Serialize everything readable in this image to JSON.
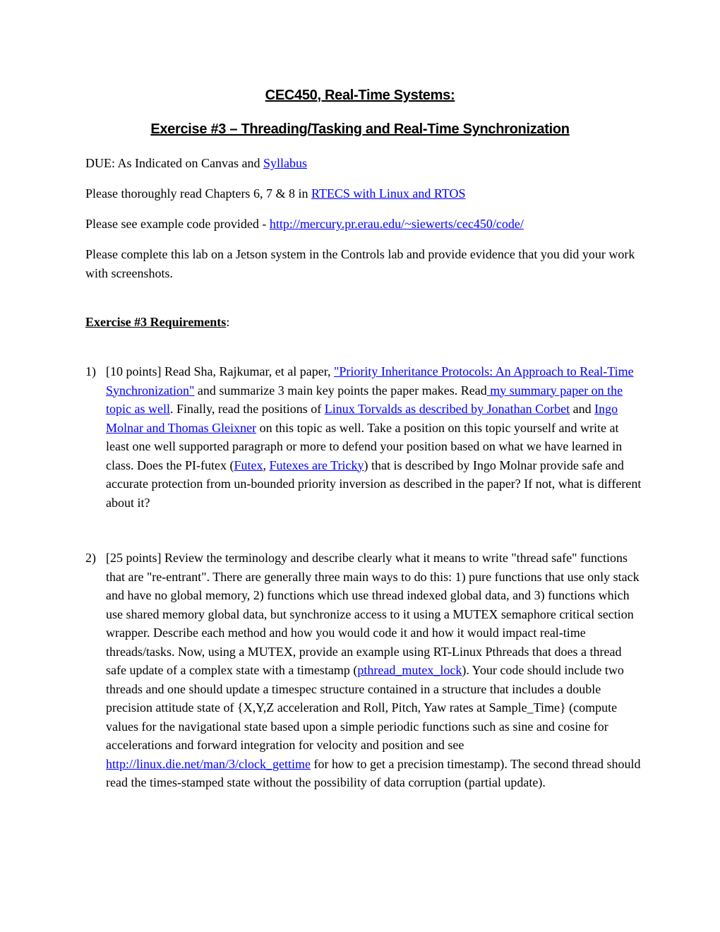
{
  "header": {
    "title": "CEC450, Real-Time Systems:",
    "subtitle": "Exercise #3 – Threading/Tasking and Real-Time Synchronization"
  },
  "intro": {
    "due_prefix": "DUE: As Indicated on Canvas and ",
    "due_link": "Syllabus",
    "read_prefix": "Please thoroughly read Chapters 6, 7 & 8 in ",
    "read_link": "RTECS with Linux and RTOS",
    "code_prefix": "Please see example code provided - ",
    "code_link": "http://mercury.pr.erau.edu/~siewerts/cec450/code/",
    "jetson_text": "Please complete this lab on a Jetson system in the Controls lab and provide evidence that you did your work with screenshots."
  },
  "requirements": {
    "heading": "Exercise #3 Requirements",
    "colon": ":"
  },
  "items": [
    {
      "number": "1)",
      "t1": "[10 points] Read Sha, Rajkumar, et al paper, ",
      "link_paper": "\"Priority Inheritance Protocols: An Approach to Real-Time Synchronization\"",
      "t2": " and summarize 3 main key points the paper makes. Read",
      "link_summary": " my summary paper on the topic as well",
      "t3": ". Finally, read the positions of ",
      "link_torvalds": "Linux Torvalds as described by Jonathan Corbet",
      "t4": " and ",
      "link_molnar": "Ingo Molnar and Thomas Gleixner",
      "t5": " on this topic as well. Take a position on this topic yourself and write at least one well supported paragraph or more to defend your position based on what we have learned in class. Does the PI-futex (",
      "link_futex": "Futex",
      "t6": ", ",
      "link_tricky": "Futexes are Tricky",
      "t7": ") that is described by Ingo Molnar provide safe and accurate protection from un-bounded priority inversion as described in the paper? If not, what is different about it?"
    },
    {
      "number": "2)",
      "t1": "[25 points] Review the terminology and describe clearly what it means to write \"thread safe\" functions that are \"re-entrant\". There are generally three main ways to do this: 1) pure functions that use only stack and have no global memory, 2) functions which use thread indexed global data, and 3) functions which use shared memory global data, but synchronize access to it using a MUTEX semaphore critical section wrapper. Describe each method and how you would code it and how it would impact real-time threads/tasks.  Now, using a MUTEX, provide an example using RT-Linux Pthreads that does a thread safe update of a complex state with a timestamp (",
      "link_mutex": "pthread_mutex_lock",
      "t2": ").  Your code should include two threads and one should update a timespec structure contained in a structure that includes a double precision attitude state of {X,Y,Z acceleration and Roll, Pitch, Yaw rates at Sample_Time} (compute values for the navigational state based upon a simple periodic functions such as sine and cosine for accelerations and forward integration for velocity and position and see ",
      "link_clock": "http://linux.die.net/man/3/clock_gettime",
      "t3": " for how to get a precision timestamp).  The second thread should read the times-stamped state without the possibility of data corruption (partial update)."
    }
  ],
  "colors": {
    "link": "#0000ff",
    "text": "#000000",
    "background": "#ffffff"
  }
}
